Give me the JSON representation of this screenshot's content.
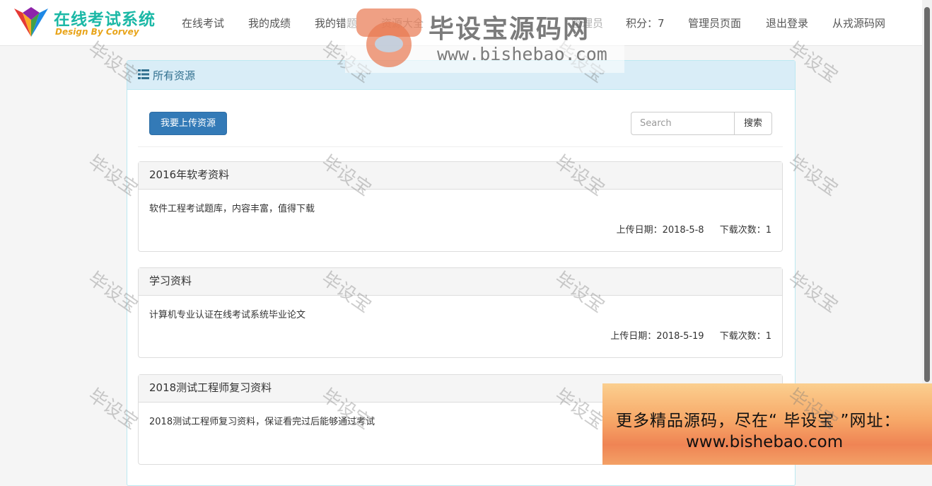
{
  "brand": {
    "title": "在线考试系统",
    "subtitle": "Design By Corvey"
  },
  "nav": {
    "items": [
      {
        "label": "在线考试"
      },
      {
        "label": "我的成绩"
      },
      {
        "label": "我的错题"
      },
      {
        "label": "资源大全"
      },
      {
        "label": "管理员"
      },
      {
        "label": "积分：7"
      },
      {
        "label": "管理员页面"
      },
      {
        "label": "退出登录"
      },
      {
        "label": "从戎源码网"
      }
    ]
  },
  "panel": {
    "title": "所有资源",
    "upload_button": "我要上传资源",
    "search": {
      "placeholder": "Search",
      "value": "",
      "button": "搜索"
    }
  },
  "resources": [
    {
      "title": "2016年软考资料",
      "description": "软件工程考试题库，内容丰富，值得下载",
      "upload_date": "上传日期：2018-5-8",
      "downloads": "下载次数：1"
    },
    {
      "title": "学习资料",
      "description": "计算机专业认证在线考试系统毕业论文",
      "upload_date": "上传日期：2018-5-19",
      "downloads": "下载次数：1"
    },
    {
      "title": "2018测试工程师复习资料",
      "description": "2018测试工程师复习资料，保证看完过后能够通过考试",
      "upload_date": "",
      "downloads": ""
    }
  ],
  "watermark": {
    "text": "毕设宝",
    "logo_title": "毕设宝源码网",
    "logo_url": "www.bishebao.com",
    "ad_line1": "更多精品源码，尽在“ 毕设宝 ”网址：",
    "ad_line2": "www.bishebao.com"
  },
  "colors": {
    "primary": "#337ab7",
    "panel_heading_bg": "#d9edf7",
    "panel_heading_text": "#31708f",
    "brand_teal": "#1bb8a6",
    "brand_orange": "#e8a41a"
  }
}
